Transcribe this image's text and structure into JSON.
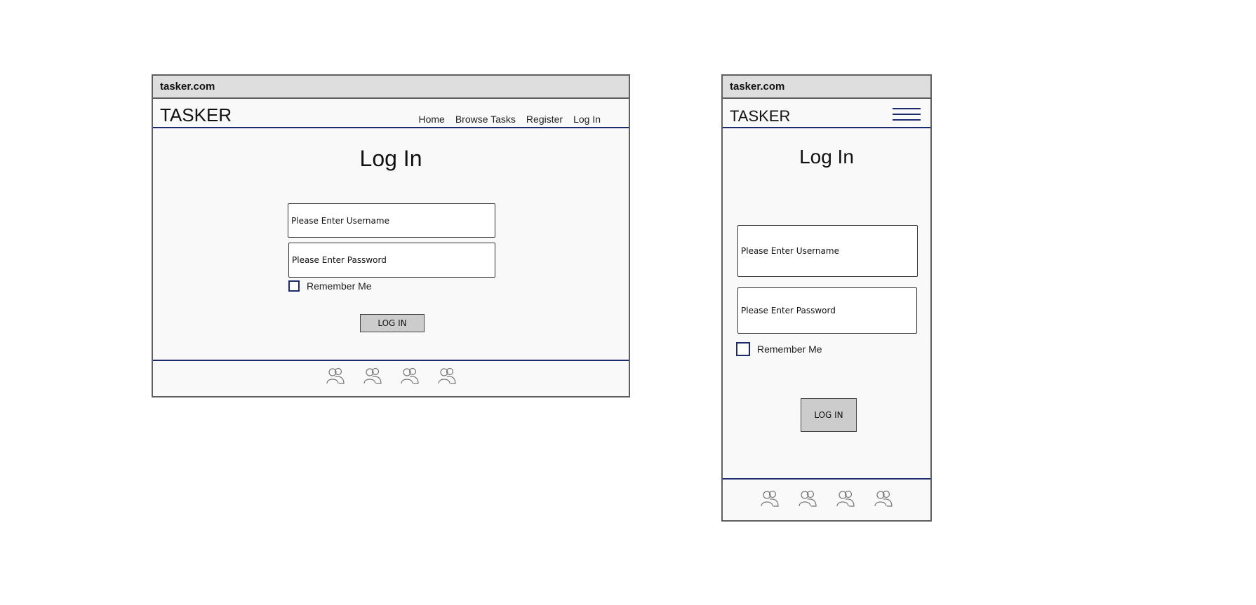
{
  "desktop": {
    "address": "tasker.com",
    "brand": "TASKER",
    "nav": [
      "Home",
      "Browse Tasks",
      "Register",
      "Log In"
    ],
    "title": "Log In",
    "username_placeholder": "Please Enter Username",
    "password_placeholder": "Please Enter Password",
    "remember_label": "Remember Me",
    "login_button": "LOG IN",
    "footer_icons": [
      "users-icon",
      "users-icon",
      "users-icon",
      "users-icon"
    ]
  },
  "mobile": {
    "address": "tasker.com",
    "brand": "TASKER",
    "menu_icon": "hamburger-menu-icon",
    "title": "Log In",
    "username_placeholder": "Please Enter Username",
    "password_placeholder": "Please Enter Password",
    "remember_label": "Remember Me",
    "login_button": "LOG IN",
    "footer_icons": [
      "users-icon",
      "users-icon",
      "users-icon",
      "users-icon"
    ]
  },
  "colors": {
    "accent": "#1e2a6e",
    "frame_border": "#5f5f5f",
    "address_bar": "#dedede",
    "button": "#cccccc"
  }
}
